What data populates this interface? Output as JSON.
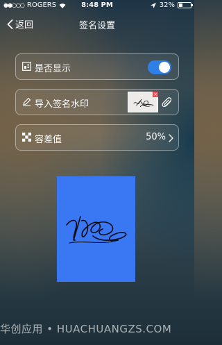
{
  "status_bar": {
    "signal_dots": "●●○○○",
    "carrier": "ROGERS",
    "time": "8:48 PM",
    "battery_percent": "32%",
    "battery_level": 0.32
  },
  "nav": {
    "back_label": "返回",
    "title": "签名设置"
  },
  "settings": {
    "show": {
      "label": "是否显示",
      "enabled": true
    },
    "import": {
      "label": "导入签名水印",
      "thumbnail_delete": "×"
    },
    "tolerance": {
      "label": "容差值",
      "value": "50%"
    }
  },
  "watermark": "华创应用 • HUACHUANGZS.COM",
  "colors": {
    "accent": "#2e7fe6",
    "preview_bg": "#3a77f2",
    "delete_badge": "#e94b57"
  },
  "icons": [
    "wifi-icon",
    "location-icon",
    "battery-icon",
    "chevron-left-icon",
    "display-icon",
    "pen-icon",
    "paperclip-icon",
    "checker-icon",
    "chevron-right-icon"
  ]
}
